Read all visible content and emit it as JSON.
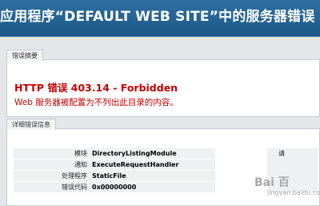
{
  "header": {
    "title": "应用程序“DEFAULT WEB SITE”中的服务器错误"
  },
  "error_panel": {
    "tab_label": "错误摘要",
    "title": "HTTP 错误 403.14 - Forbidden",
    "message": "Web 服务器被配置为不列出此目录的内容。"
  },
  "detail_panel": {
    "tab_label": "详细错误信息",
    "rows": [
      {
        "key": "模块",
        "value": "DirectoryListingModule"
      },
      {
        "key": "通知",
        "value": "ExecuteRequestHandler"
      },
      {
        "key": "处理程序",
        "value": "StaticFile"
      },
      {
        "key": "错误代码",
        "value": "0x00000000"
      }
    ],
    "right_label": "请"
  },
  "watermark": {
    "text": "Bai 百",
    "sub": "jingyan.baidu.com"
  },
  "colors": {
    "header": "#1f5f8c",
    "error_red": "#c50000",
    "background": "#e4e6e9"
  }
}
